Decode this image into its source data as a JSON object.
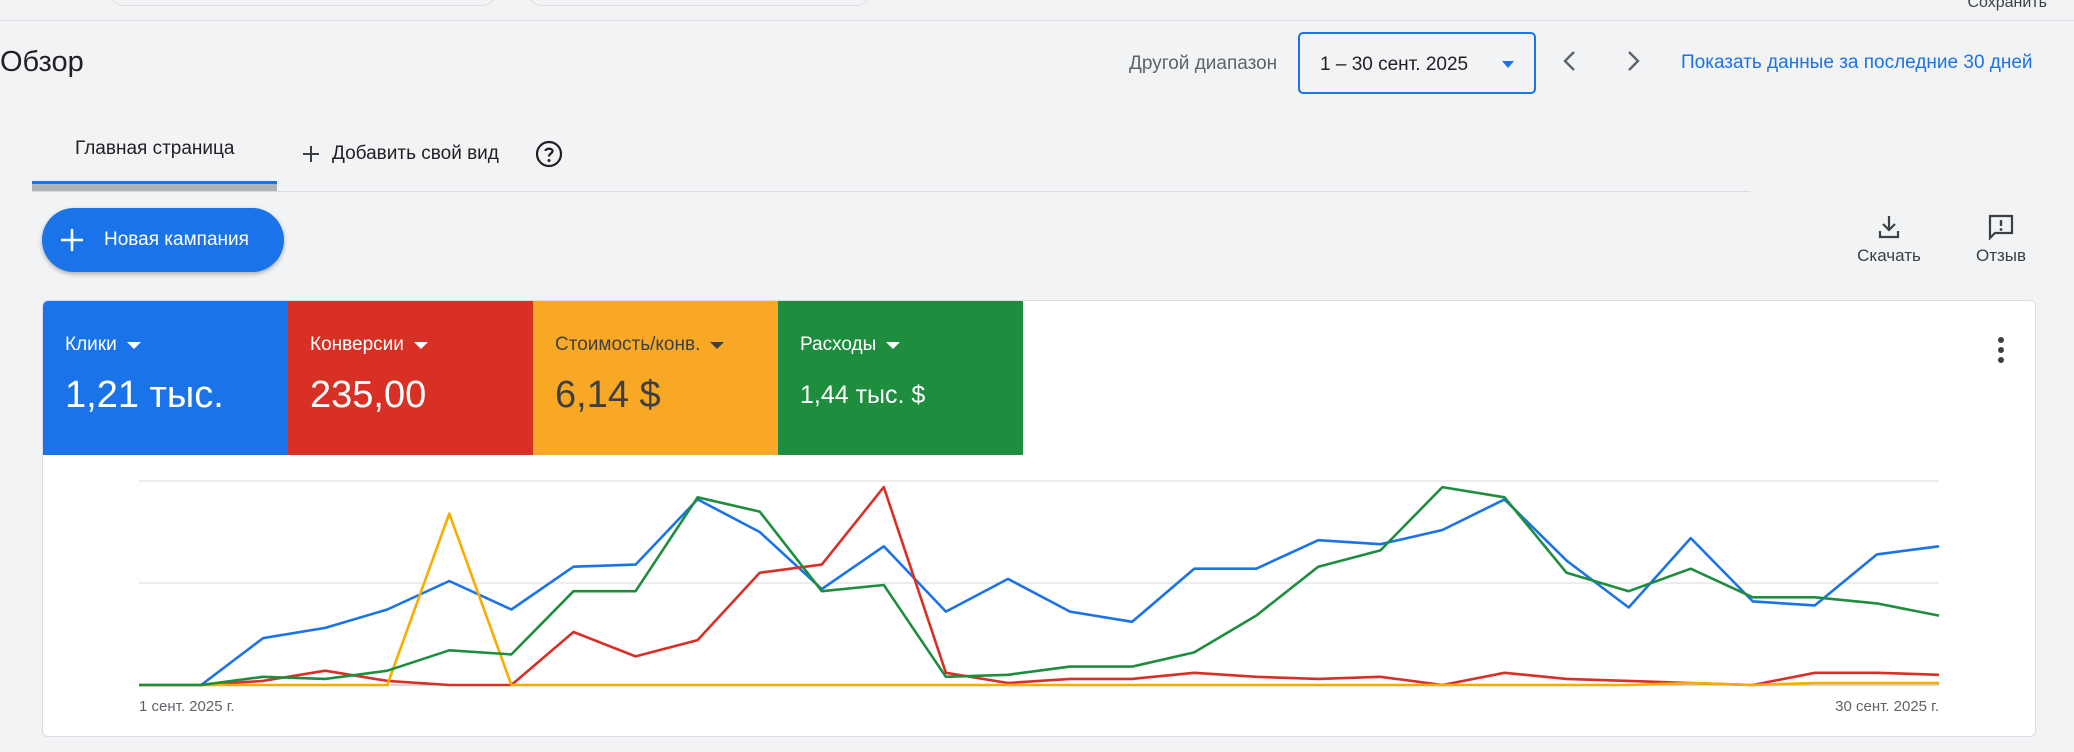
{
  "header": {
    "title": "Обзор",
    "save_label": "Сохранить",
    "range_label": "Другой диапазон",
    "date_range": "1 – 30 сент. 2025",
    "show_last30": "Показать данные за последние 30 дней"
  },
  "tabs": {
    "home": "Главная страница",
    "add_view": "Добавить свой вид"
  },
  "actions": {
    "new_campaign": "Новая кампания",
    "download": "Скачать",
    "feedback": "Отзыв"
  },
  "metrics": [
    {
      "label": "Клики",
      "value": "1,21 тыс.",
      "color": "#1a73e8"
    },
    {
      "label": "Конверсии",
      "value": "235,00",
      "color": "#d93025"
    },
    {
      "label": "Стоимость/конв.",
      "value": "6,14 $",
      "color": "#f9ab00"
    },
    {
      "label": "Расходы",
      "value": "1,44 тыс. $",
      "color": "#1e8e3e"
    }
  ],
  "chart_data": {
    "type": "line",
    "x_start_label": "1 сент. 2025 г.",
    "x_end_label": "30 сент. 2025 г.",
    "ylim": [
      0,
      100
    ],
    "grid": true,
    "series": [
      {
        "key": "clicks",
        "color": "#1a73e8",
        "values": [
          0,
          0,
          23,
          28,
          37,
          51,
          37,
          58,
          59,
          91,
          75,
          47,
          68,
          36,
          52,
          36,
          31,
          57,
          57,
          71,
          69,
          76,
          91,
          61,
          38,
          72,
          41,
          39,
          64,
          68
        ]
      },
      {
        "key": "conversions",
        "color": "#d93025",
        "values": [
          0,
          0,
          2,
          7,
          2,
          0,
          0,
          26,
          14,
          22,
          55,
          59,
          97,
          6,
          1,
          3,
          3,
          6,
          4,
          3,
          4,
          0,
          6,
          3,
          2,
          1,
          0,
          6,
          6,
          5
        ]
      },
      {
        "key": "cost_per_conv",
        "color": "#f9ab00",
        "values": [
          0,
          0,
          0,
          0,
          0,
          84,
          0,
          0,
          0,
          0,
          0,
          0,
          0,
          0,
          0,
          0,
          0,
          0,
          0,
          0,
          0,
          0,
          0,
          0,
          0,
          1,
          0,
          1,
          1,
          1
        ]
      },
      {
        "key": "cost",
        "color": "#1e8e3e",
        "values": [
          0,
          0,
          4,
          3,
          7,
          17,
          15,
          46,
          46,
          92,
          85,
          46,
          49,
          4,
          5,
          9,
          9,
          16,
          34,
          58,
          66,
          97,
          92,
          55,
          46,
          57,
          43,
          43,
          40,
          34
        ]
      }
    ]
  }
}
